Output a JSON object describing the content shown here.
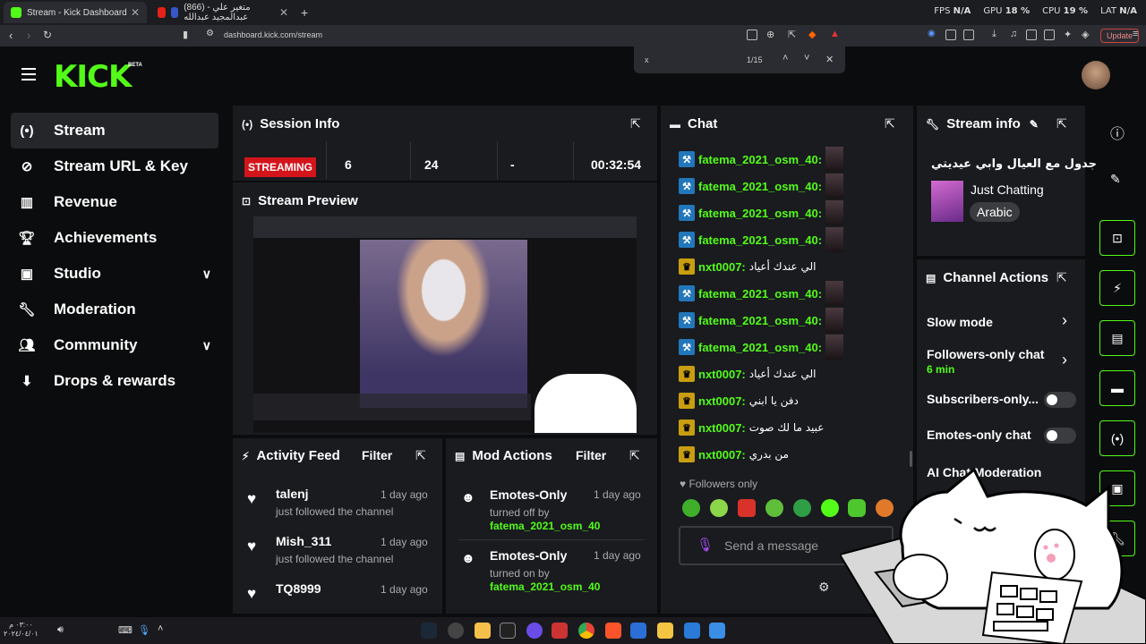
{
  "browser": {
    "tabs": [
      {
        "title": "Stream - Kick Dashboard",
        "active": true
      },
      {
        "title": "(866) متغير علي - عبدالمجيد عبدالله",
        "active": false
      }
    ],
    "url": "dashboard.kick.com/stream",
    "update_label": "Update",
    "find": {
      "query": "x",
      "count": "1/15"
    },
    "stats": {
      "fps_label": "FPS",
      "fps": "N/A",
      "gpu_label": "GPU",
      "gpu": "18 %",
      "cpu_label": "CPU",
      "cpu": "19 %",
      "lat_label": "LAT",
      "lat": "N/A"
    }
  },
  "header": {
    "logo": "KICK",
    "beta": "BETA"
  },
  "sidebar": {
    "items": [
      {
        "label": "Stream",
        "icon": "stream-icon",
        "active": true
      },
      {
        "label": "Stream URL & Key",
        "icon": "link-icon"
      },
      {
        "label": "Revenue",
        "icon": "chart-icon"
      },
      {
        "label": "Achievements",
        "icon": "trophy-icon"
      },
      {
        "label": "Studio",
        "icon": "studio-icon",
        "expandable": true
      },
      {
        "label": "Moderation",
        "icon": "wrench-icon"
      },
      {
        "label": "Community",
        "icon": "people-icon",
        "expandable": true
      },
      {
        "label": "Drops & rewards",
        "icon": "drops-icon"
      }
    ]
  },
  "session": {
    "title": "Session Info",
    "status": "STREAMING",
    "viewers": "6",
    "followers": "24",
    "subs": "-",
    "duration": "00:32:54"
  },
  "preview": {
    "title": "Stream Preview"
  },
  "activity": {
    "title": "Activity Feed",
    "filter": "Filter",
    "items": [
      {
        "name": "talenj",
        "time": "1 day ago",
        "desc": "just followed the channel"
      },
      {
        "name": "Mish_311",
        "time": "1 day ago",
        "desc": "just followed the channel"
      },
      {
        "name": "TQ8999",
        "time": "1 day ago",
        "desc": ""
      }
    ]
  },
  "mod_actions": {
    "title": "Mod Actions",
    "filter": "Filter",
    "items": [
      {
        "action": "Emotes-Only",
        "time": "1 day ago",
        "desc": "turned off by",
        "user": "fatema_2021_osm_40"
      },
      {
        "action": "Emotes-Only",
        "time": "1 day ago",
        "desc": "turned on by",
        "user": "fatema_2021_osm_40"
      }
    ]
  },
  "chat": {
    "title": "Chat",
    "messages": [
      {
        "badge": "mod",
        "user": "fatema_2021_osm_40:",
        "text": ""
      },
      {
        "badge": "mod",
        "user": "fatema_2021_osm_40:",
        "text": ""
      },
      {
        "badge": "mod",
        "user": "fatema_2021_osm_40:",
        "text": ""
      },
      {
        "badge": "mod",
        "user": "fatema_2021_osm_40:",
        "text": ""
      },
      {
        "badge": "crown",
        "user": "nxt0007:",
        "text": "الي عندك أعياد"
      },
      {
        "badge": "mod",
        "user": "fatema_2021_osm_40:",
        "text": ""
      },
      {
        "badge": "mod",
        "user": "fatema_2021_osm_40:",
        "text": ""
      },
      {
        "badge": "mod",
        "user": "fatema_2021_osm_40:",
        "text": ""
      },
      {
        "badge": "crown",
        "user": "nxt0007:",
        "text": "الي عندك أعياد"
      },
      {
        "badge": "crown",
        "user": "nxt0007:",
        "text": "دفن يا ابني"
      },
      {
        "badge": "crown",
        "user": "nxt0007:",
        "text": "عبيد ما لك صوت"
      },
      {
        "badge": "crown",
        "user": "nxt0007:",
        "text": "من بدري"
      }
    ],
    "followers_only": "Followers only",
    "placeholder": "Send a message"
  },
  "stream_info": {
    "title": "Stream info",
    "stream_title": "جدول مع العيال وابي عيديتي",
    "category": "Just Chatting",
    "language": "Arabic"
  },
  "channel_actions": {
    "title": "Channel Actions",
    "slow_mode": "Slow mode",
    "followers_only": "Followers-only chat",
    "followers_only_value": "6 min",
    "subscribers_only": "Subscribers-only...",
    "emotes_only": "Emotes-only chat",
    "ai_moderation": "AI Chat Moderation"
  },
  "taskbar": {
    "clock_time": "٠٣:٠٠ م",
    "clock_date": "٢٠٢٤/٠٤/٠١"
  }
}
